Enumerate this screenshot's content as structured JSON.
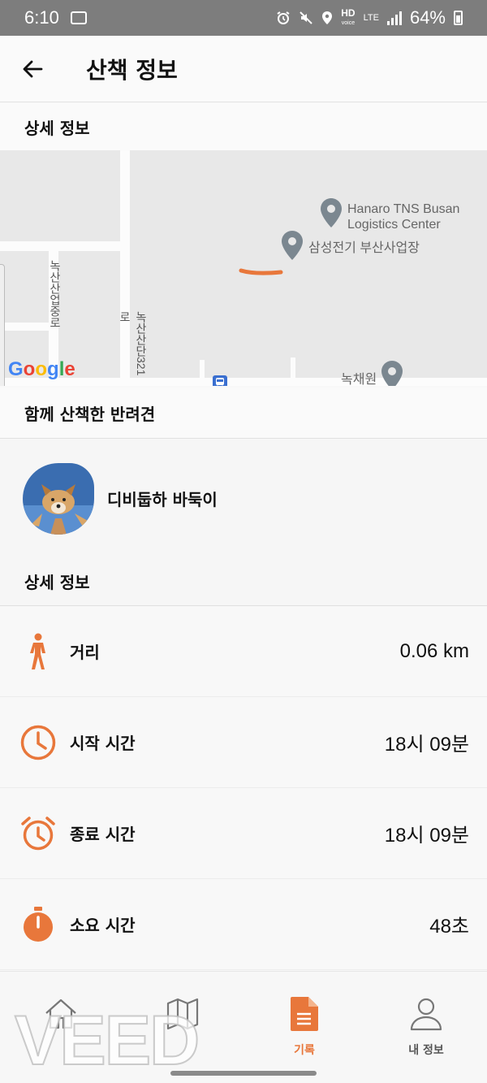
{
  "status_bar": {
    "time": "6:10",
    "network_hd": "HD",
    "network_voice": "voice",
    "network_lte": "LTE",
    "battery": "64%"
  },
  "app_bar": {
    "title": "산책 정보"
  },
  "map_section": {
    "header": "상세 정보"
  },
  "map": {
    "poi_1": "Hanaro TNS Busan Logistics Center",
    "poi_1_line1": "Hanaro TNS Busan",
    "poi_1_line2": "Logistics Center",
    "poi_2": "삼성전기 부산사업장",
    "poi_3": "녹채원",
    "street_1": "녹산산단321로",
    "street_2": "녹산산업중로",
    "logo": "Google",
    "route_color": "#e8773b"
  },
  "pets_section": {
    "header": "함께 산책한 반려견",
    "pets": [
      {
        "name": "디비둡하 바둑이"
      }
    ]
  },
  "details_section": {
    "header": "상세 정보",
    "items": [
      {
        "icon": "walking-icon",
        "label": "거리",
        "value": "0.06 km"
      },
      {
        "icon": "clock-icon",
        "label": "시작 시간",
        "value": "18시 09분"
      },
      {
        "icon": "alarm-clock-icon",
        "label": "종료 시간",
        "value": "18시 09분"
      },
      {
        "icon": "stopwatch-icon",
        "label": "소요 시간",
        "value": "48초"
      }
    ]
  },
  "bottom_nav": {
    "items": [
      {
        "icon": "home-icon",
        "label": ""
      },
      {
        "icon": "map-icon",
        "label": ""
      },
      {
        "icon": "document-icon",
        "label": "기록",
        "active": true
      },
      {
        "icon": "person-icon",
        "label": "내 정보"
      }
    ]
  },
  "watermark": "VEED",
  "colors": {
    "accent": "#e8773b",
    "status_bar": "#7d7d7d",
    "map_bg": "#e8e8e8"
  }
}
